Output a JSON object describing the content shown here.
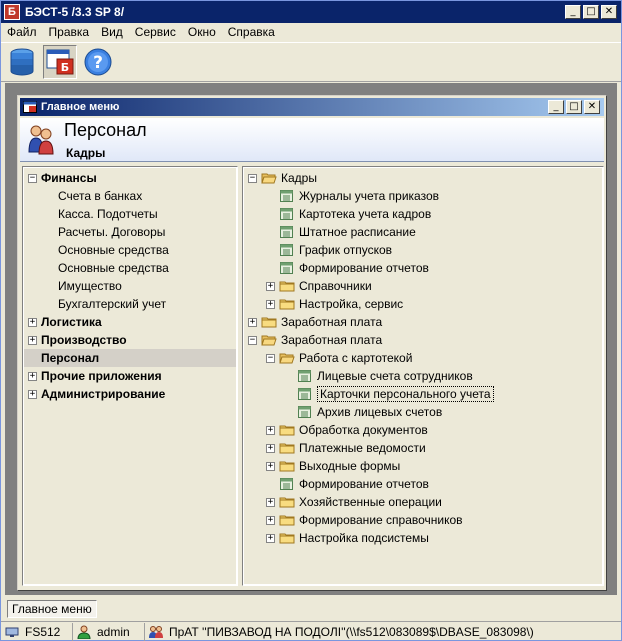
{
  "window": {
    "title": "БЭСТ-5 /3.3 SP 8/",
    "app_icon_letter": "Б",
    "min": "_",
    "max": "□",
    "close": "✕"
  },
  "menu": [
    "Файл",
    "Правка",
    "Вид",
    "Сервис",
    "Окно",
    "Справка"
  ],
  "toolbar": {
    "help_label": "?"
  },
  "child": {
    "title": "Главное меню",
    "header_title": "Персонал",
    "header_sub": "Кадры"
  },
  "left_tree": [
    {
      "label": "Финансы",
      "level": 0,
      "exp": "−",
      "bold": true
    },
    {
      "label": "Счета в банках",
      "level": 1
    },
    {
      "label": "Касса. Подотчеты",
      "level": 1
    },
    {
      "label": "Расчеты. Договоры",
      "level": 1
    },
    {
      "label": "Основные средства",
      "level": 1
    },
    {
      "label": "Основные средства",
      "level": 1
    },
    {
      "label": "Имущество",
      "level": 1
    },
    {
      "label": "Бухгалтерский учет",
      "level": 1
    },
    {
      "label": "Логистика",
      "level": 0,
      "exp": "+",
      "bold": true
    },
    {
      "label": "Производство",
      "level": 0,
      "exp": "+",
      "bold": true
    },
    {
      "label": "Персонал",
      "level": 0,
      "exp": "",
      "bold": true,
      "selected": true
    },
    {
      "label": "Прочие приложения",
      "level": 0,
      "exp": "+",
      "bold": true
    },
    {
      "label": "Администрирование",
      "level": 0,
      "exp": "+",
      "bold": true
    }
  ],
  "right_tree": [
    {
      "label": "Кадры",
      "level": 0,
      "exp": "−",
      "icon": "folder-open"
    },
    {
      "label": "Журналы учета приказов",
      "level": 1,
      "icon": "doc"
    },
    {
      "label": "Картотека учета кадров",
      "level": 1,
      "icon": "doc"
    },
    {
      "label": "Штатное расписание",
      "level": 1,
      "icon": "doc"
    },
    {
      "label": "График отпусков",
      "level": 1,
      "icon": "doc"
    },
    {
      "label": "Формирование отчетов",
      "level": 1,
      "icon": "doc"
    },
    {
      "label": "Справочники",
      "level": 1,
      "exp": "+",
      "icon": "folder"
    },
    {
      "label": "Настройка, сервис",
      "level": 1,
      "exp": "+",
      "icon": "folder"
    },
    {
      "label": "Заработная плата",
      "level": 0,
      "exp": "+",
      "icon": "folder"
    },
    {
      "label": "Заработная плата",
      "level": 0,
      "exp": "−",
      "icon": "folder-open"
    },
    {
      "label": "Работа с картотекой",
      "level": 1,
      "exp": "−",
      "icon": "folder-open"
    },
    {
      "label": "Лицевые счета сотрудников",
      "level": 2,
      "icon": "doc"
    },
    {
      "label": "Карточки персонального учета",
      "level": 2,
      "icon": "doc",
      "selected": true
    },
    {
      "label": "Архив лицевых счетов",
      "level": 2,
      "icon": "doc"
    },
    {
      "label": "Обработка документов",
      "level": 1,
      "exp": "+",
      "icon": "folder"
    },
    {
      "label": "Платежные ведомости",
      "level": 1,
      "exp": "+",
      "icon": "folder"
    },
    {
      "label": "Выходные формы",
      "level": 1,
      "exp": "+",
      "icon": "folder"
    },
    {
      "label": "Формирование отчетов",
      "level": 1,
      "icon": "doc"
    },
    {
      "label": "Хозяйственные операции",
      "level": 1,
      "exp": "+",
      "icon": "folder"
    },
    {
      "label": "Формирование справочников",
      "level": 1,
      "exp": "+",
      "icon": "folder"
    },
    {
      "label": "Настройка подсистемы",
      "level": 1,
      "exp": "+",
      "icon": "folder"
    }
  ],
  "taskbar": {
    "task": "Главное меню"
  },
  "status": {
    "server": "FS512",
    "user": "admin",
    "company": "ПрАТ ''ПИВЗАВОД НА ПОДОЛІ''(\\\\fs512\\083089$\\DBASE_083098\\)"
  }
}
